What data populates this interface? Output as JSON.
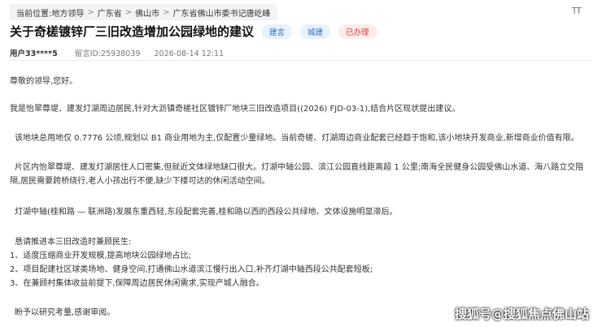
{
  "breadcrumb": {
    "label": "当前位置:",
    "items": [
      "地方领导",
      "广东省",
      "佛山市",
      "广东省佛山市委书记唐屹峰"
    ],
    "separator": ">"
  },
  "font_size_icon": "TT",
  "header": {
    "title": "关于奇槎镀锌厂三旧改造增加公园绿地的建议",
    "tags": [
      "建言",
      "城建",
      "已办理"
    ]
  },
  "meta": {
    "user": "用户33****5",
    "message_id": "留言ID:25938039",
    "datetime": "2026-08-14 12:11"
  },
  "content": {
    "greeting": "尊敬的领导,您好。",
    "p1": "我是怡翠尊堤、建发灯湖周边居民,针对大沥镇奇槎社区镀锌厂地块三旧改造项目((2026) FJD-03-1),结合片区现状提出建议。",
    "p2": "该地块总用地仅 0.7776 公顷,规划以 B1 商业用地为主,仅配置少量绿地。当前奇槎、灯湖周边商业配套已经趋于饱和,该小地块开发商业,新增商业价值有限。",
    "p3": "片区内怡翠尊堤、建发灯湖居住人口密集,但就近文体绿地缺口很大。灯湖中轴公园、滨江公园直线距离超 1 公里;南海全民健身公园受佛山水道、海八路立交阻隔,居民需要跨桥绕行,老人小孩出行不便,缺少下楼可达的休闲活动空间。",
    "p4": "灯湖中轴(桂和路 — 联洲路)发展东重西轻,东段配套完善,桂和路以西的西段公共绿地、文体设施明显滞后。",
    "request_intro": "恳请推进本三旧改造时兼顾民生:",
    "requests": [
      "1、适度压缩商业开发规模,提高地块公园绿地占比;",
      "2、项目配建社区球类场地、健身空间,打通佛山水道滨江慢行出入口,补齐灯湖中轴西段公共配套短板;",
      "3、在兼顾村集体收益前提下,保障周边居民休闲需求,实现产城人融合。"
    ],
    "closing": "盼予以研究考量,感谢审阅。"
  },
  "watermark": "搜狐号@搜狐焦点佛山站"
}
